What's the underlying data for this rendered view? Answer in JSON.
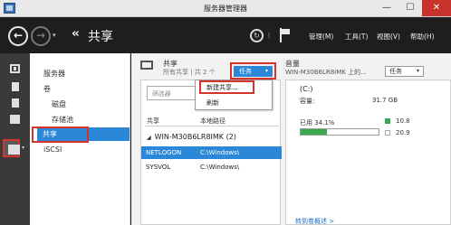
{
  "window": {
    "title": "服务器管理器",
    "min_label": "—",
    "max_label": "☐",
    "close_label": "✕"
  },
  "header": {
    "back_icon": "←",
    "forward_icon": "→",
    "dropdown_icon": "▾",
    "breadcrumb_arrows": "‹‹",
    "breadcrumb": "共享",
    "refresh_icon": "↻",
    "separator": "|",
    "menus": [
      "管理(M)",
      "工具(T)",
      "视图(V)",
      "帮助(H)"
    ]
  },
  "nav": {
    "items": [
      "服务器",
      "卷",
      "磁盘",
      "存储池",
      "共享",
      "iSCSI"
    ],
    "selected": "共享"
  },
  "shares": {
    "title": "共享",
    "subtitle": "所有共享 | 共 2 个",
    "tasks_label": "任务",
    "tasks_arrow": "▾",
    "filter_placeholder": "筛选器",
    "columns": [
      "共享",
      "本地路径"
    ],
    "group_label": "WIN-M30B6LR8IMK (2)",
    "group_toggle": "◢",
    "rows": [
      {
        "name": "NETLOGON",
        "path": "C:\\Windows\\"
      },
      {
        "name": "SYSVOL",
        "path": "C:\\Windows\\"
      }
    ],
    "selected_row": "NETLOGON",
    "menu": {
      "new_share": "新建共享...",
      "refresh": "刷新"
    }
  },
  "volume": {
    "title": "音量",
    "subtitle": "WIN-M30B6LR8IMK 上的...",
    "tasks_label": "任务",
    "tasks_arrow": "▾",
    "drive": "(C:)",
    "capacity_label": "容量:",
    "capacity_value": "31.7 GB",
    "used_label": "已用 34.1%",
    "used_fraction": 0.341,
    "used_value": "10.8",
    "free_value": "20.9",
    "link": "转到卷概述 >"
  },
  "colors": {
    "accent": "#2b88d8",
    "highlight_box": "#d9322b",
    "used_bar": "#3aa84f"
  }
}
